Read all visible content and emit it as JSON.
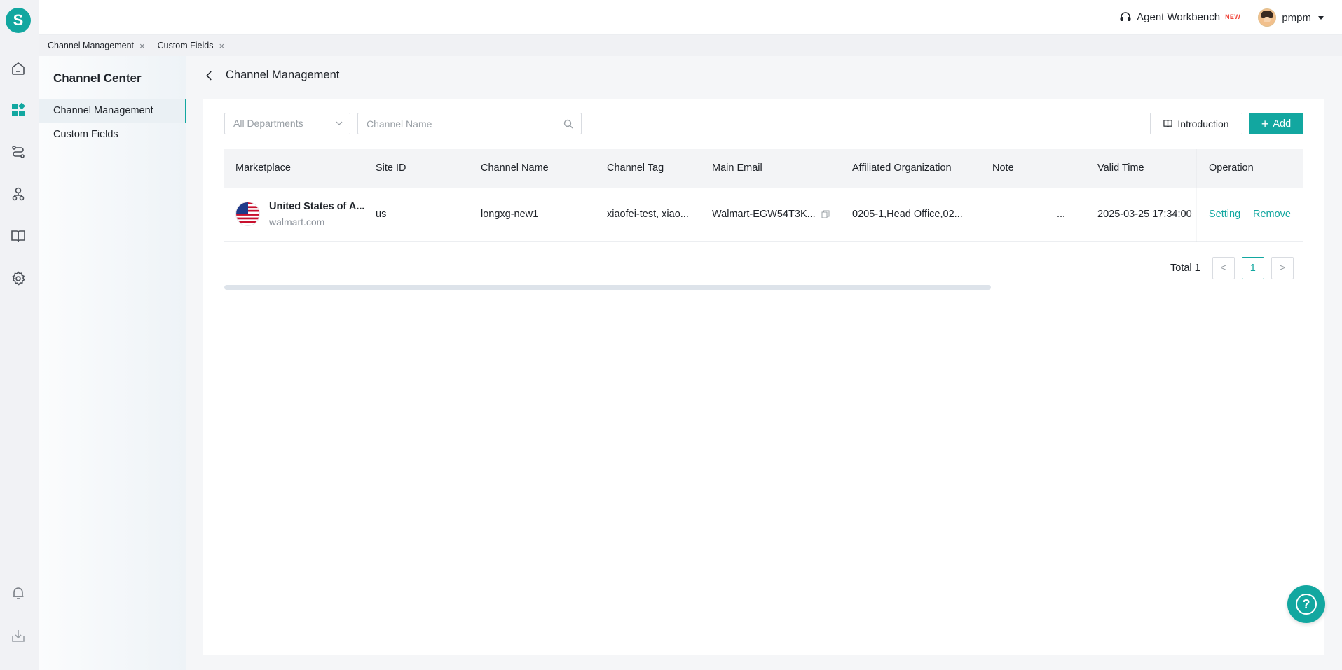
{
  "app": {
    "logo_letter": "S"
  },
  "rail": {
    "items": [
      {
        "icon": "home-icon"
      },
      {
        "icon": "apps-grid-icon",
        "active": true
      },
      {
        "icon": "route-icon"
      },
      {
        "icon": "user-tree-icon"
      },
      {
        "icon": "book-icon"
      },
      {
        "icon": "gear-icon"
      },
      {
        "icon": "bell-icon"
      },
      {
        "icon": "download-icon"
      }
    ]
  },
  "header": {
    "workbench_label": "Agent Workbench",
    "new_badge": "NEW",
    "username": "pmpm"
  },
  "tabs": [
    {
      "label": "Channel Management",
      "close": "×"
    },
    {
      "label": "Custom Fields",
      "close": "×"
    }
  ],
  "subnav": {
    "title": "Channel Center",
    "items": [
      {
        "label": "Channel Management",
        "active": true
      },
      {
        "label": "Custom Fields",
        "active": false
      }
    ]
  },
  "page": {
    "title": "Channel Management"
  },
  "filters": {
    "department_placeholder": "All Departments",
    "channel_name_placeholder": "Channel Name",
    "channel_name_value": ""
  },
  "buttons": {
    "introduction": "Introduction",
    "add": "Add",
    "add_symbol": "+"
  },
  "table": {
    "columns": [
      "Marketplace",
      "Site ID",
      "Channel Name",
      "Channel Tag",
      "Main Email",
      "Affiliated Organization",
      "Note",
      "Valid Time",
      "Operation"
    ],
    "rows": [
      {
        "marketplace_name": "United States of A...",
        "marketplace_domain": "walmart.com",
        "site_id": "us",
        "channel_name": "longxg-new1",
        "channel_tag": "xiaofei-test, xiao...",
        "main_email": "Walmart-EGW54T3K...",
        "affiliated_org": "0205-1,Head Office,02...",
        "note": "...",
        "valid_time": "2025-03-25 17:34:00",
        "actions": {
          "setting": "Setting",
          "remove": "Remove"
        }
      }
    ]
  },
  "pagination": {
    "total_label": "Total 1",
    "prev": "<",
    "current_page": "1",
    "next": ">"
  },
  "help": {
    "label": "?"
  },
  "colors": {
    "accent": "#12a7a0",
    "new_badge": "#f0483e"
  }
}
